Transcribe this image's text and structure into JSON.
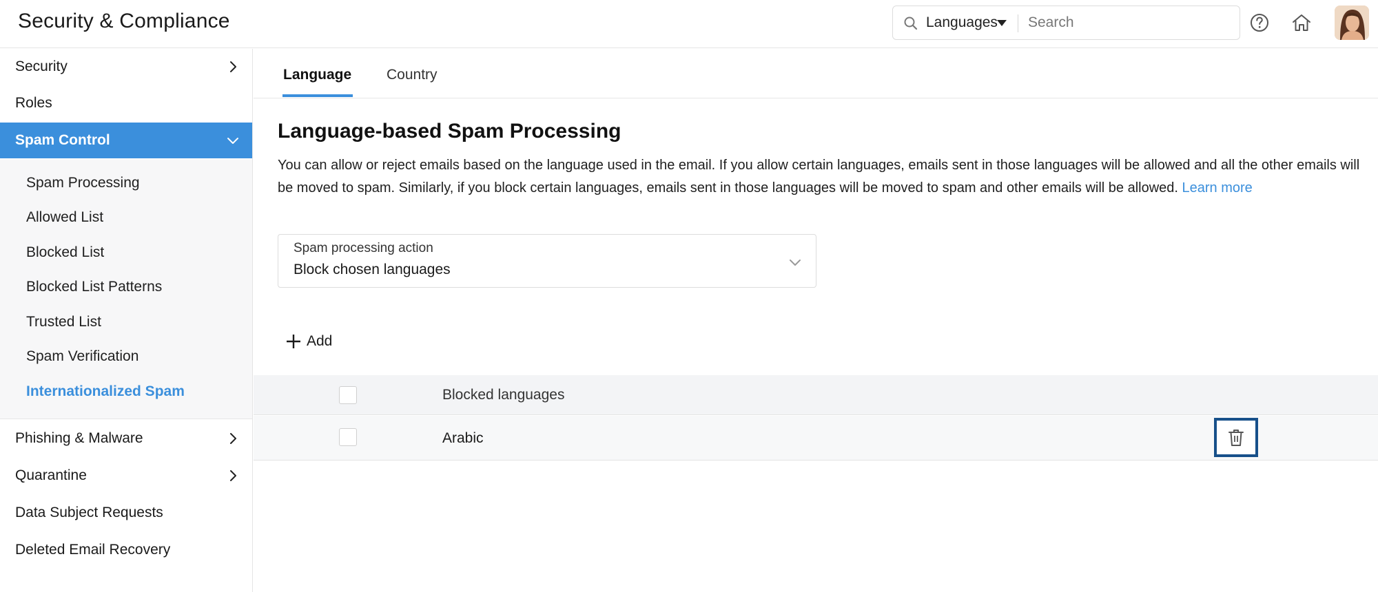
{
  "header": {
    "title": "Security & Compliance",
    "search_scope": "Languages",
    "search_placeholder": "Search"
  },
  "sidebar": {
    "items": [
      {
        "label": "Security",
        "has_chevron": true
      },
      {
        "label": "Roles",
        "has_chevron": false
      },
      {
        "label": "Spam Control",
        "active": true,
        "expanded": true
      },
      {
        "label": "Phishing & Malware",
        "has_chevron": true
      },
      {
        "label": "Quarantine",
        "has_chevron": true
      },
      {
        "label": "Data Subject Requests",
        "has_chevron": false
      },
      {
        "label": "Deleted Email Recovery",
        "has_chevron": false
      }
    ],
    "sub_items": [
      {
        "label": "Spam Processing"
      },
      {
        "label": "Allowed List"
      },
      {
        "label": "Blocked List"
      },
      {
        "label": "Blocked List Patterns"
      },
      {
        "label": "Trusted List"
      },
      {
        "label": "Spam Verification"
      },
      {
        "label": "Internationalized Spam",
        "current": true
      }
    ]
  },
  "tabs": [
    {
      "label": "Language",
      "active": true
    },
    {
      "label": "Country",
      "active": false
    }
  ],
  "main": {
    "title": "Language-based Spam Processing",
    "description": "You can allow or reject emails based on the language used in the email. If you allow certain languages, emails sent in those languages will be allowed and all the other emails will be moved to spam. Similarly, if you block certain languages, emails sent in those languages will be moved to spam and other emails will be allowed.",
    "learn_more": "Learn more",
    "action_select": {
      "label": "Spam processing action",
      "value": "Block chosen languages"
    },
    "add_label": "Add",
    "table": {
      "header": "Blocked languages",
      "rows": [
        {
          "language": "Arabic"
        }
      ]
    }
  },
  "colors": {
    "accent": "#3b8fdc",
    "focus_border": "#17508a"
  }
}
